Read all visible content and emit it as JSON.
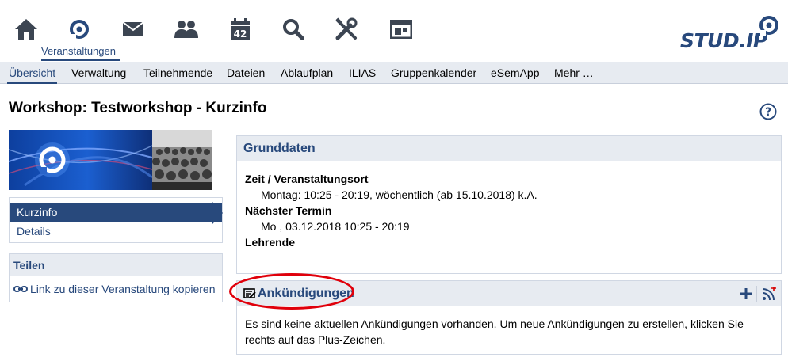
{
  "nav": {
    "active_label": "Veranstaltungen",
    "icons": [
      "home-icon",
      "courses-icon",
      "messages-icon",
      "community-icon",
      "calendar-icon",
      "search-icon",
      "tools-icon",
      "admin-icon"
    ],
    "calendar_day": "42"
  },
  "logo": {
    "text": "STUD.IP"
  },
  "tabs": [
    "Übersicht",
    "Verwaltung",
    "Teilnehmende",
    "Dateien",
    "Ablaufplan",
    "ILIAS",
    "Gruppenkalender",
    "eSemApp",
    "Mehr …"
  ],
  "page": {
    "title": "Workshop: Testworkshop - Kurzinfo",
    "help": "?"
  },
  "sidebar": {
    "menu": [
      "Kurzinfo",
      "Details"
    ],
    "share": {
      "title": "Teilen",
      "link": "Link zu dieser Veranstaltung kopieren"
    }
  },
  "grunddaten": {
    "title": "Grunddaten",
    "zeit_label": "Zeit / Veranstaltungsort",
    "zeit_value": "Montag: 10:25 - 20:19, wöchentlich (ab 15.10.2018) k.A.",
    "termin_label": "Nächster Termin",
    "termin_value": "Mo , 03.12.2018 10:25 - 20:19",
    "lehrende_label": "Lehrende"
  },
  "ankuendigungen": {
    "title": "Ankündigungen",
    "body": "Es sind keine aktuellen Ankündigungen vorhanden. Um neue Ankündigungen zu erstellen, klicken Sie rechts auf das Plus-Zeichen."
  },
  "colors": {
    "brand": "#28497c",
    "tab_bg": "#e7ebf1",
    "highlight": "#e0000b"
  }
}
